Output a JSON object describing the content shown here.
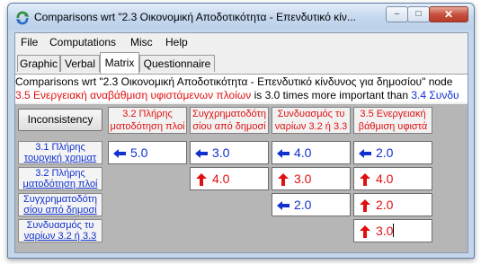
{
  "window": {
    "title": "Comparisons wrt \"2.3 Οικονομική Αποδοτικότητα - Επενδυτικό κίν...",
    "min_label": "–",
    "max_label": "□",
    "close_label": "✕"
  },
  "menu": [
    "File",
    "Computations",
    "Misc",
    "Help"
  ],
  "tabs": [
    "Graphic",
    "Verbal",
    "Matrix",
    "Questionnaire"
  ],
  "active_tab": "Matrix",
  "description": "Comparisons wrt \"2.3 Οικονομική Αποδοτικότητα - Επενδυτικό κίνδυνος  για δημοσίου\" node",
  "comparison": {
    "left": "3.5 Ενεργειακή αναβάθμιση υφιστάμενων πλοίων",
    "middle": " is 3.0 times more important than ",
    "right": "3.4 Συνδυ"
  },
  "inconsistency_label": "Inconsistency",
  "column_headers": [
    {
      "line1": "3.2 Πλήρης",
      "line2": "ματοδότηση πλοί"
    },
    {
      "line1": "Συγχρηματοδότη",
      "line2": "σίου από δημοσί"
    },
    {
      "line1": "Συνδυασμός τυ",
      "line2": "ναρίων 3.2 ή 3.3"
    },
    {
      "line1": "3.5 Ενεργειακή",
      "line2": "βάθμιση υφιστά"
    }
  ],
  "row_headers": [
    {
      "line1": "3.1 Πλήρης",
      "line2": "τουργική χρηματ"
    },
    {
      "line1": "3.2 Πλήρης",
      "line2": "ματοδότηση πλοί"
    },
    {
      "line1": "Συγχρηματοδότη",
      "line2": "σίου από δημοσί"
    },
    {
      "line1": "Συνδυασμός τυ",
      "line2": "ναρίων 3.2 ή 3.3"
    }
  ],
  "cells": [
    [
      {
        "value": "5.0",
        "dir": "left",
        "color": "blue"
      },
      {
        "value": "3.0",
        "dir": "left",
        "color": "blue"
      },
      {
        "value": "4.0",
        "dir": "left",
        "color": "blue"
      },
      {
        "value": "2.0",
        "dir": "left",
        "color": "blue"
      }
    ],
    [
      null,
      {
        "value": "4.0",
        "dir": "up",
        "color": "red"
      },
      {
        "value": "3.0",
        "dir": "up",
        "color": "red"
      },
      {
        "value": "4.0",
        "dir": "up",
        "color": "red"
      }
    ],
    [
      null,
      null,
      {
        "value": "2.0",
        "dir": "left",
        "color": "blue"
      },
      {
        "value": "2.0",
        "dir": "up",
        "color": "red"
      }
    ],
    [
      null,
      null,
      null,
      {
        "value": "3.0",
        "dir": "up",
        "color": "red"
      }
    ]
  ],
  "colors": {
    "blue": "#1030d0",
    "red": "#e01010"
  }
}
